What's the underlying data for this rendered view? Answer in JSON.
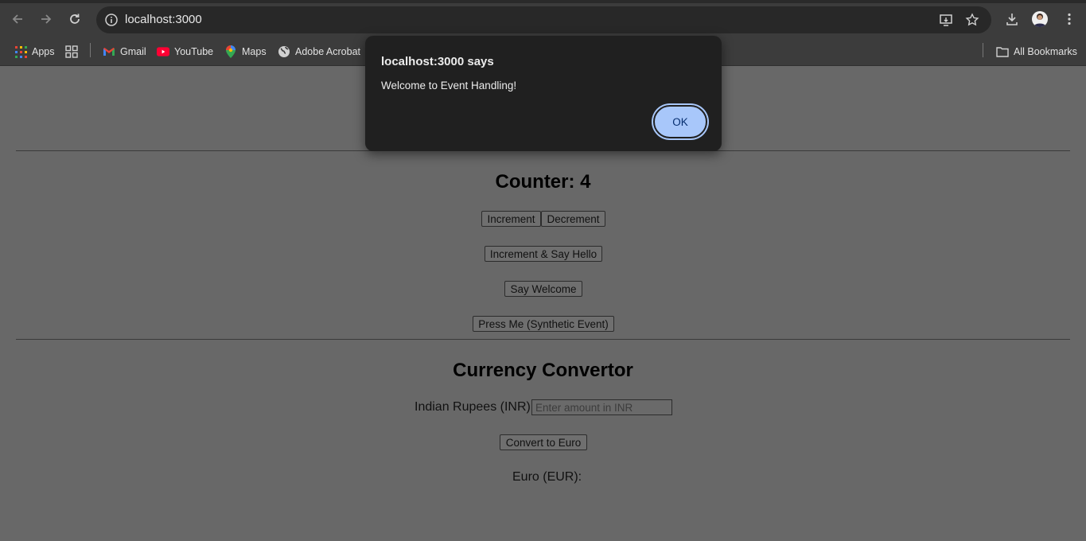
{
  "browser": {
    "url": "localhost:3000",
    "bookmarks": [
      {
        "label": "Apps",
        "icon": "apps-grid-icon"
      },
      {
        "label": "Gmail",
        "icon": "gmail-icon"
      },
      {
        "label": "YouTube",
        "icon": "youtube-icon"
      },
      {
        "label": "Maps",
        "icon": "maps-icon"
      },
      {
        "label": "Adobe Acrobat",
        "icon": "globe-icon"
      }
    ],
    "all_bookmarks": "All Bookmarks"
  },
  "counter": {
    "heading": "Counter: 4",
    "increment": "Increment",
    "decrement": "Decrement",
    "increment_hello": "Increment & Say Hello",
    "say_welcome": "Say Welcome",
    "press_me": "Press Me (Synthetic Event)"
  },
  "currency": {
    "heading": "Currency Convertor",
    "inr_label": "Indian Rupees (INR):",
    "inr_placeholder": "Enter amount in INR",
    "convert": "Convert to Euro",
    "eur_label": "Euro (EUR):"
  },
  "alert": {
    "title": "localhost:3000 says",
    "message": "Welcome to Event Handling!",
    "ok": "OK"
  },
  "colors": {
    "chrome": "#3c3c3c",
    "page_dim": "#686868",
    "dialog": "#202020",
    "ok_button": "#a8c7fa"
  }
}
